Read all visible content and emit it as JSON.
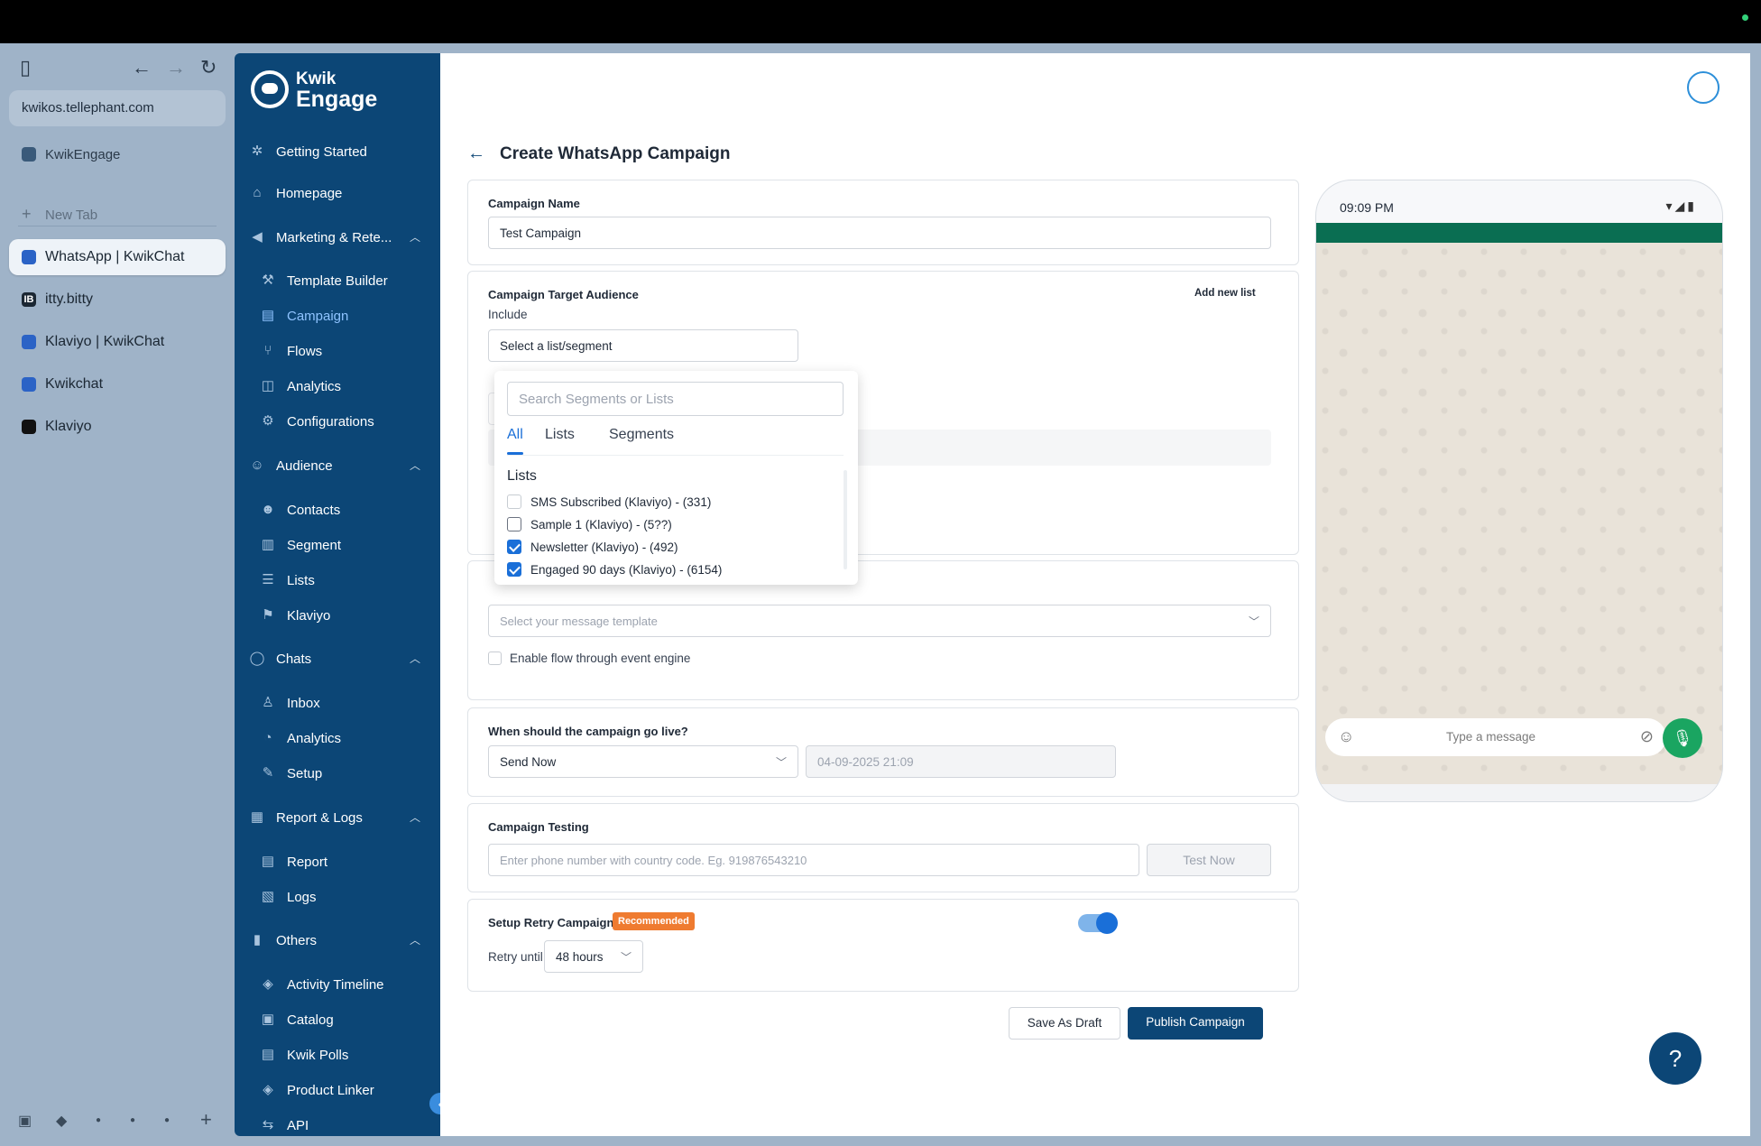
{
  "browser": {
    "url": "kwikos.tellephant.com",
    "pinned": "KwikEngage",
    "new_tab": "New Tab",
    "tabs": [
      {
        "label": "WhatsApp | KwikChat"
      },
      {
        "label": "itty.bitty"
      },
      {
        "label": "Klaviyo | KwikChat"
      },
      {
        "label": "Kwikchat"
      },
      {
        "label": "Klaviyo"
      }
    ]
  },
  "brand": {
    "line1": "Kwik",
    "line2": "Engage"
  },
  "nav": {
    "getting_started": "Getting Started",
    "homepage": "Homepage",
    "marketing": "Marketing & Rete...",
    "template_builder": "Template Builder",
    "campaign": "Campaign",
    "flows": "Flows",
    "analytics": "Analytics",
    "configurations": "Configurations",
    "audience": "Audience",
    "contacts": "Contacts",
    "segment": "Segment",
    "lists": "Lists",
    "klaviyo": "Klaviyo",
    "chats": "Chats",
    "inbox": "Inbox",
    "chat_analytics": "Analytics",
    "setup": "Setup",
    "report_logs": "Report & Logs",
    "report": "Report",
    "logs": "Logs",
    "others": "Others",
    "activity_timeline": "Activity Timeline",
    "catalog": "Catalog",
    "kwik_polls": "Kwik Polls",
    "product_linker": "Product Linker",
    "api": "API"
  },
  "page": {
    "title": "Create WhatsApp Campaign"
  },
  "campaign_name": {
    "label": "Campaign Name",
    "value": "Test Campaign"
  },
  "audience": {
    "label": "Campaign Target Audience",
    "add_new_list": "Add new list",
    "include": "Include",
    "select_value": "Select a list/segment"
  },
  "dropdown": {
    "search_placeholder": "Search Segments or Lists",
    "tabs": [
      "All",
      "Lists",
      "Segments"
    ],
    "group_header": "Lists",
    "items": [
      {
        "label": "SMS Subscribed (Klaviyo) - (331)",
        "checked": false
      },
      {
        "label": "Sample 1 (Klaviyo) - (5??)",
        "checked": false
      },
      {
        "label": "Newsletter (Klaviyo) - (492)",
        "checked": true
      },
      {
        "label": "Engaged 90 days (Klaviyo) - (6154)",
        "checked": true
      }
    ]
  },
  "message": {
    "template_placeholder": "Select your message template",
    "flow_checkbox": "Enable flow through event engine"
  },
  "schedule": {
    "label": "When should the campaign go live?",
    "mode": "Send Now",
    "datetime": "04-09-2025 21:09"
  },
  "testing": {
    "label": "Campaign Testing",
    "phone_placeholder": "Enter phone number with country code. Eg. 919876543210",
    "test_button": "Test Now"
  },
  "retry": {
    "label": "Setup Retry Campaigns",
    "badge": "Recommended",
    "retry_until": "Retry until",
    "duration": "48 hours",
    "enabled": true
  },
  "actions": {
    "save_draft": "Save As Draft",
    "publish": "Publish Campaign"
  },
  "preview": {
    "time": "09:09 PM",
    "message_placeholder": "Type a message"
  },
  "colors": {
    "sidebar": "#0c4676",
    "accent": "#1a6fd8",
    "whatsapp_green": "#0a6e52",
    "badge": "#ef7b30"
  }
}
